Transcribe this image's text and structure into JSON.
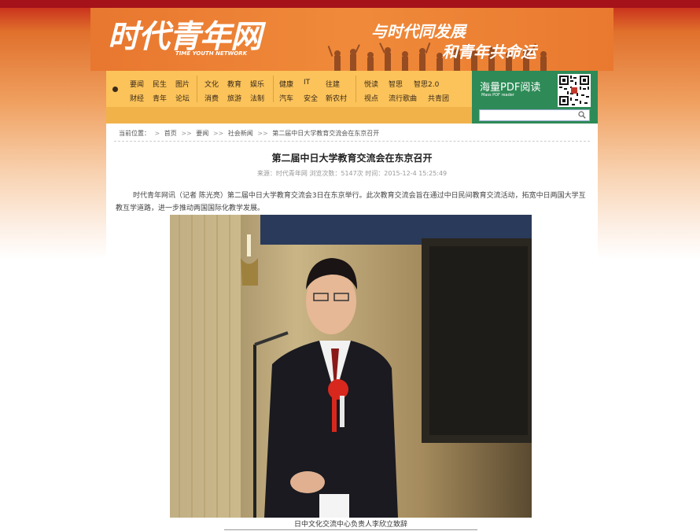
{
  "header": {
    "logo": "时代青年网",
    "logo_sub": "TIME YOUTH NETWORK",
    "slogan_1": "与时代同发展",
    "slogan_2": "和青年共命运"
  },
  "nav": {
    "row1": [
      "要闻",
      "民生",
      "图片",
      "文化",
      "教育",
      "娱乐",
      "健康",
      "IT",
      "往建",
      "悦读",
      "智思",
      "智思2.0"
    ],
    "row2": [
      "财经",
      "青年",
      "论坛",
      "消费",
      "旅游",
      "法制",
      "汽车",
      "安全",
      "新农村",
      "视点",
      "流行歌曲",
      "共青团"
    ]
  },
  "pdf": {
    "title": "海量PDF阅读",
    "subtitle": "Mass PDF reader",
    "search_placeholder": ""
  },
  "breadcrumb": {
    "prefix": "当前位置：",
    "items": [
      "首页",
      "要闻",
      "社会新闻",
      "第二届中日大学教育交流会在东京召开"
    ]
  },
  "article": {
    "title": "第二届中日大学教育交流会在东京召开",
    "meta": "来源：时代青年网  浏览次数：5147次  时间：2015-12-4  15:25:49",
    "paragraph": "时代青年网讯（记者 陈光亮）第二届中日大学教育交流会3日在东京举行。此次教育交流会旨在通过中日民间教育交流活动，拓宽中日两国大学互教互学道路，进一步推动两国国际化教学发展。",
    "caption": "日中文化交流中心负责人李欣立致辞"
  },
  "colors": {
    "header_orange": "#ec7f34",
    "nav_yellow": "#fbc35a",
    "pdf_green": "#2e8b57"
  }
}
